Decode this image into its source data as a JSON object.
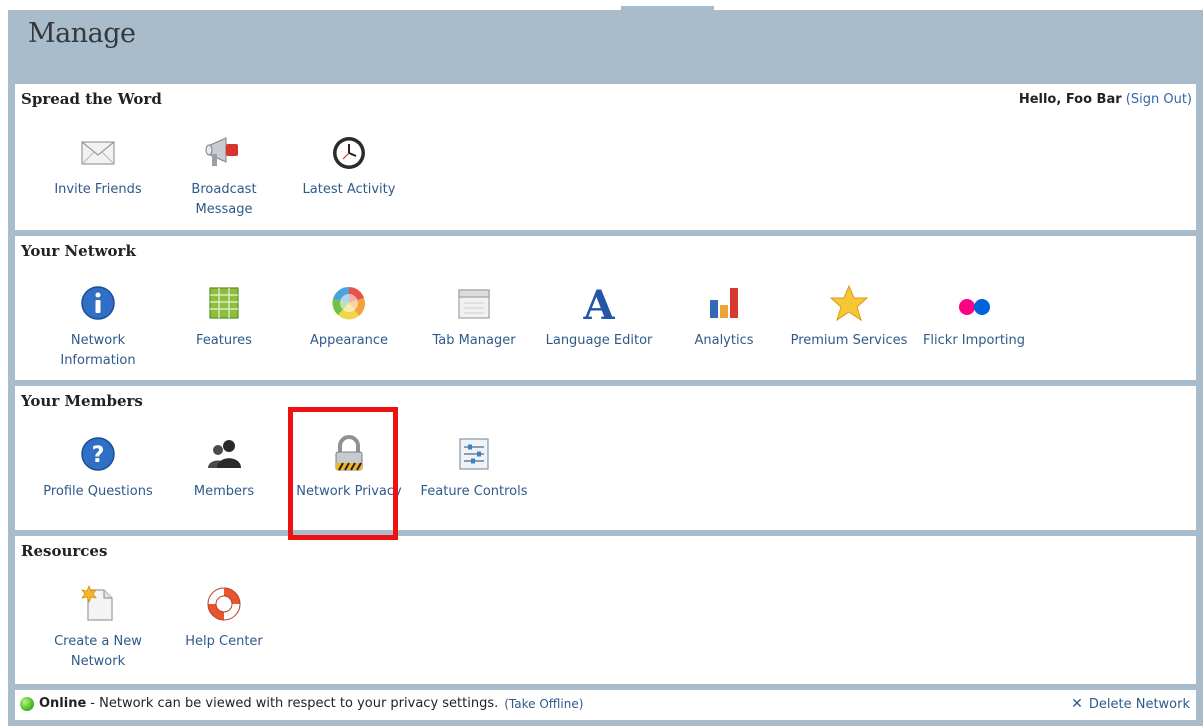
{
  "page": {
    "title": "Manage"
  },
  "header": {
    "greeting_prefix": "Hello, Foo Bar",
    "sign_out": "(Sign Out)"
  },
  "sections": [
    {
      "title": "Spread the Word",
      "items": [
        {
          "label": "Invite Friends",
          "icon": "envelope-icon"
        },
        {
          "label": "Broadcast Message",
          "icon": "megaphone-icon"
        },
        {
          "label": "Latest Activity",
          "icon": "clock-icon"
        }
      ]
    },
    {
      "title": "Your Network",
      "items": [
        {
          "label": "Network Information",
          "icon": "info-icon"
        },
        {
          "label": "Features",
          "icon": "grid-icon"
        },
        {
          "label": "Appearance",
          "icon": "color-wheel-icon"
        },
        {
          "label": "Tab Manager",
          "icon": "tab-window-icon"
        },
        {
          "label": "Language Editor",
          "icon": "letter-a-icon"
        },
        {
          "label": "Analytics",
          "icon": "bar-chart-icon"
        },
        {
          "label": "Premium Services",
          "icon": "star-icon"
        },
        {
          "label": "Flickr Importing",
          "icon": "flickr-dots-icon"
        }
      ]
    },
    {
      "title": "Your Members",
      "items": [
        {
          "label": "Profile Questions",
          "icon": "question-icon"
        },
        {
          "label": "Members",
          "icon": "people-icon"
        },
        {
          "label": "Network Privacy",
          "icon": "padlock-icon"
        },
        {
          "label": "Feature Controls",
          "icon": "sliders-icon"
        }
      ]
    },
    {
      "title": "Resources",
      "items": [
        {
          "label": "Create a New Network",
          "icon": "new-page-icon"
        },
        {
          "label": "Help Center",
          "icon": "lifebuoy-icon"
        }
      ]
    }
  ],
  "status": {
    "state": "Online",
    "description": "- Network can be viewed with respect to your privacy settings.",
    "toggle_link": "(Take Offline)",
    "delete_label": "Delete Network"
  },
  "colors": {
    "frame": "#a9bccb",
    "link": "#2e5a8a",
    "highlight": "#ee1111",
    "online": "#41b81a"
  }
}
